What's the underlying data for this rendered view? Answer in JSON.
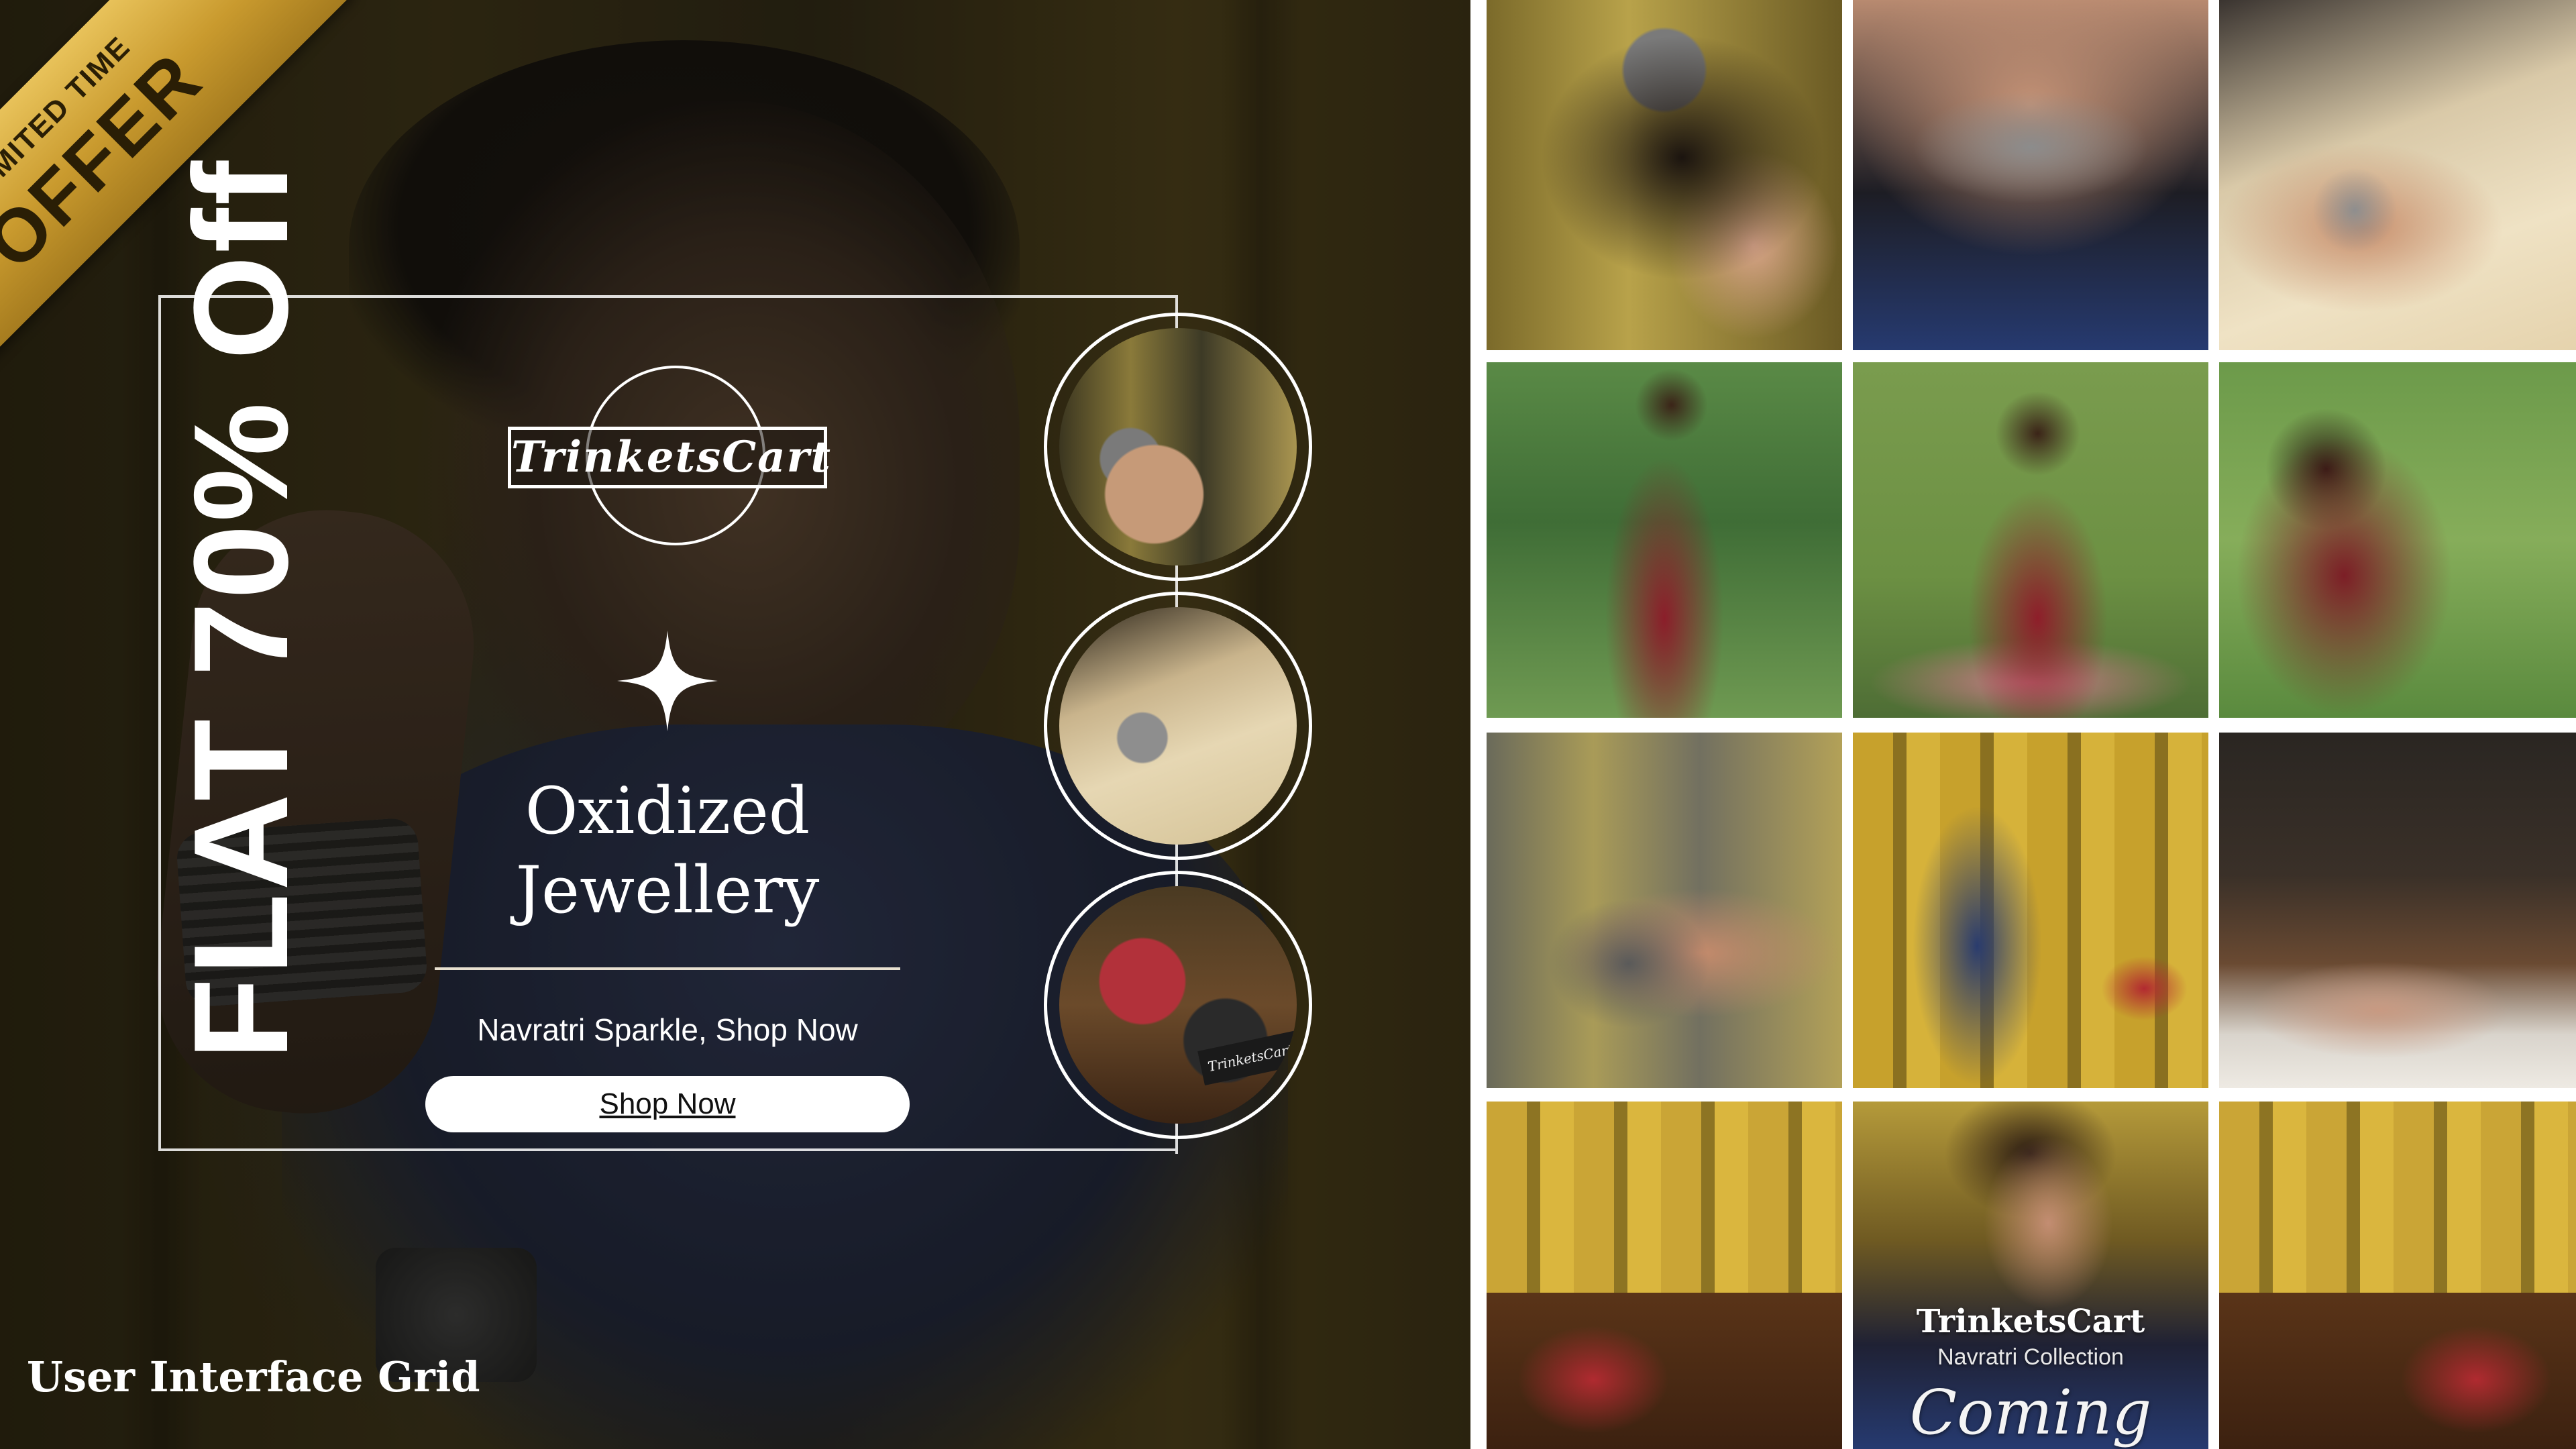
{
  "banner": {
    "ribbon": {
      "top_text": "LIMITED TIME",
      "main_text": "OFFER"
    },
    "vertical_text": "FLAT 70% Off",
    "logo_text": "TrinketsCart",
    "heading_line1": "Oxidized",
    "heading_line2": "Jewellery",
    "tagline": "Navratri Sparkle, Shop Now",
    "shop_button": "Shop Now",
    "circle_box_label": "TrinketsCart",
    "caption": "User Interface Grid"
  },
  "grid": {
    "promo_tile": {
      "brand": "TrinketsCart",
      "collection": "Navratri Collection",
      "coming_soon": "Coming Soon"
    }
  },
  "colors": {
    "ribbon_gold": "#d4a93c",
    "frame": "#ffffff"
  }
}
